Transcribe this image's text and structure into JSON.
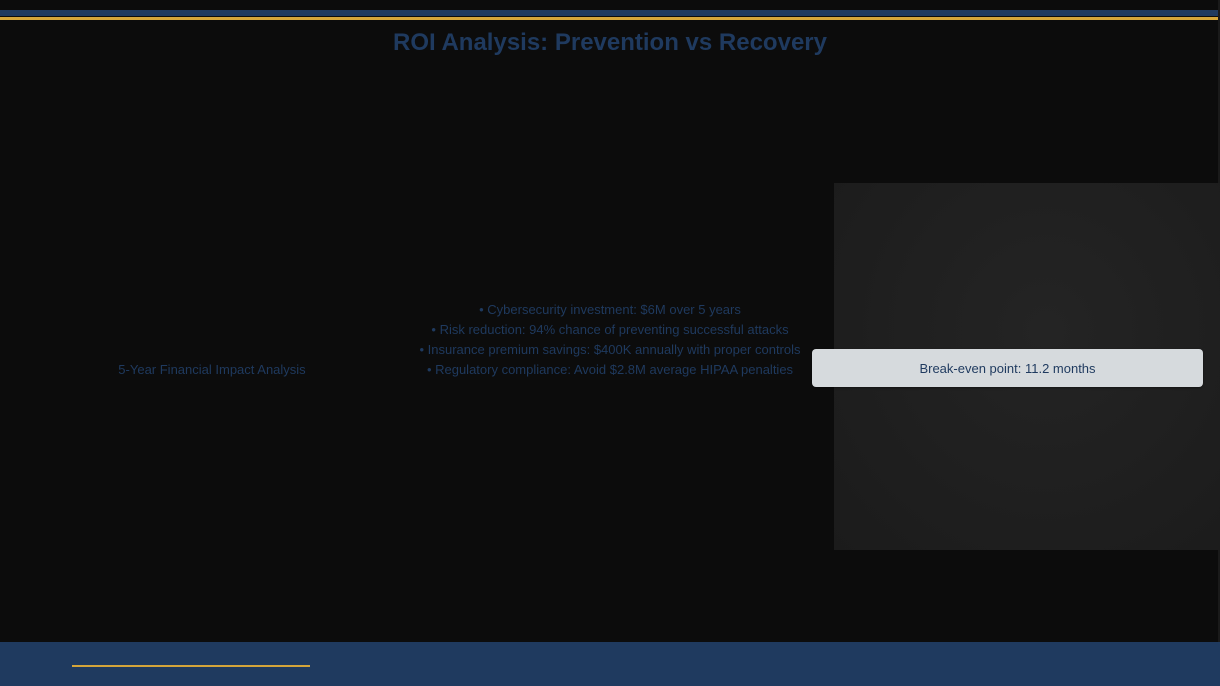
{
  "slide": {
    "title": "ROI Analysis: Prevention vs Recovery",
    "left_label": "5-Year Financial Impact Analysis",
    "bullets": [
      "• Cybersecurity investment: $6M over 5 years",
      "• Risk reduction: 94% chance of preventing successful attacks",
      "• Insurance premium savings: $400K annually with proper controls",
      "• Regulatory compliance: Avoid $2.8M average HIPAA penalties"
    ],
    "callout": "Break-even point: 11.2 months"
  },
  "colors": {
    "background": "#0c0c0c",
    "navy": "#1f3a5f",
    "gold": "#d4a53a",
    "callout_bg": "#d6dadd"
  }
}
